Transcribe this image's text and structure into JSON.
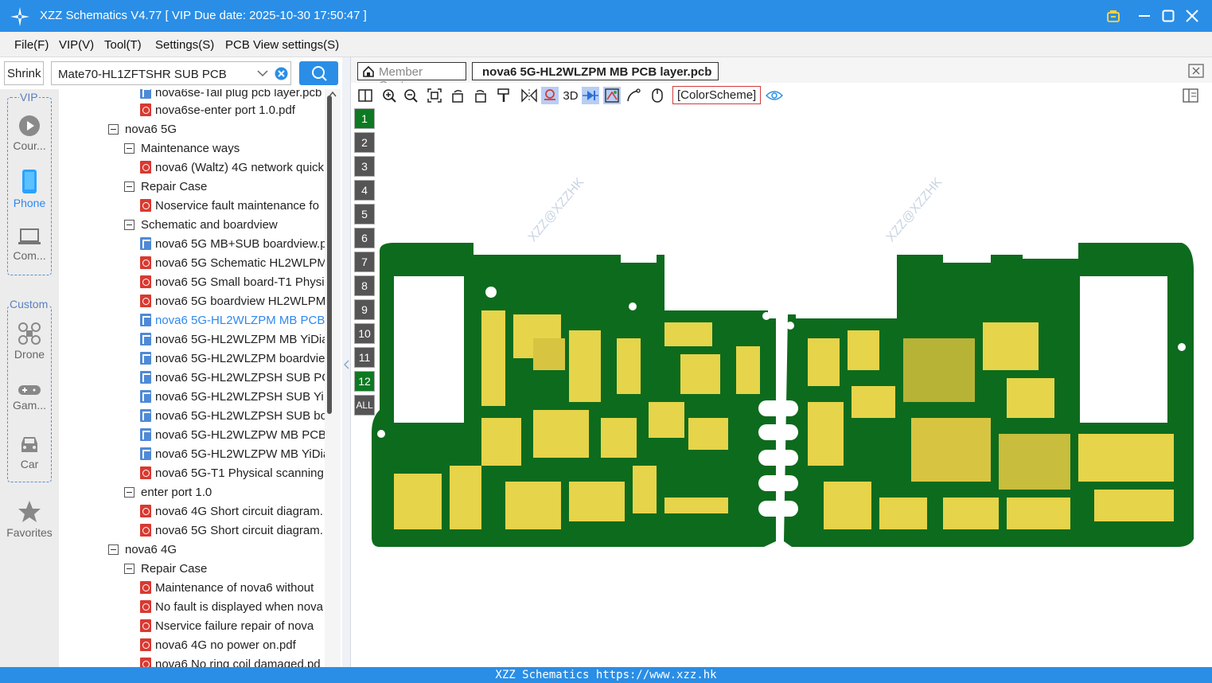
{
  "window": {
    "title": "XZZ Schematics V4.77 [ VIP Due date: 2025-10-30 17:50:47 ]",
    "icons": [
      "app-logo-icon",
      "vip-bag-icon",
      "minimize-icon",
      "maximize-icon",
      "close-icon"
    ]
  },
  "menu": {
    "file": "File(F)",
    "vip": "VIP(V)",
    "tool": "Tool(T)",
    "settings": "Settings(S)",
    "pcbview": "PCB View settings(S)"
  },
  "search": {
    "shrink_label": "Shrink",
    "model_value": "Mate70-HL1ZFTSHR SUB PCB"
  },
  "sidebar": {
    "vip_group": "VIP",
    "custom_group": "Custom",
    "items": [
      {
        "label": "Cour...",
        "icon": "play-icon"
      },
      {
        "label": "Phone",
        "icon": "phone-icon"
      },
      {
        "label": "Com...",
        "icon": "laptop-icon"
      },
      {
        "label": "Drone",
        "icon": "drone-icon"
      },
      {
        "label": "Gam...",
        "icon": "gamepad-icon"
      },
      {
        "label": "Car",
        "icon": "car-icon"
      },
      {
        "label": "Favorites",
        "icon": "star-icon"
      }
    ]
  },
  "tree": [
    {
      "label": "nova6se-Tail plug pcb layer.pcb",
      "type": "pcb"
    },
    {
      "label": "nova6se-enter port 1.0.pdf",
      "type": "pdf"
    },
    {
      "label": "nova6 5G",
      "type": "folder"
    },
    {
      "label": "Maintenance ways",
      "type": "folder"
    },
    {
      "label": "nova6 (Waltz) 4G network quick",
      "type": "pdf"
    },
    {
      "label": "Repair Case",
      "type": "folder"
    },
    {
      "label": "Noservice fault maintenance fo",
      "type": "pdf"
    },
    {
      "label": "Schematic and boardview",
      "type": "folder"
    },
    {
      "label": "nova6 5G MB+SUB boardview.p",
      "type": "pcb"
    },
    {
      "label": "nova6 5G Schematic HL2WLPM",
      "type": "pdf"
    },
    {
      "label": "nova6 5G Small board-T1 Physi",
      "type": "pdf"
    },
    {
      "label": "nova6 5G boardview HL2WLPM",
      "type": "pdf"
    },
    {
      "label": "nova6 5G-HL2WLZPM MB PCB",
      "type": "pcb"
    },
    {
      "label": "nova6 5G-HL2WLZPM MB YiDia",
      "type": "pcb"
    },
    {
      "label": "nova6 5G-HL2WLZPM boardvie",
      "type": "pcb"
    },
    {
      "label": "nova6 5G-HL2WLZPSH SUB PCE",
      "type": "pcb"
    },
    {
      "label": "nova6 5G-HL2WLZPSH SUB YiD",
      "type": "pcb"
    },
    {
      "label": "nova6 5G-HL2WLZPSH SUB boa",
      "type": "pcb"
    },
    {
      "label": "nova6 5G-HL2WLZPW MB PCB",
      "type": "pcb"
    },
    {
      "label": "nova6 5G-HL2WLZPW MB YiDia",
      "type": "pcb"
    },
    {
      "label": "nova6 5G-T1 Physical scanning",
      "type": "pdf"
    },
    {
      "label": "enter port 1.0",
      "type": "folder"
    },
    {
      "label": "nova6 4G Short circuit diagram.",
      "type": "pdf"
    },
    {
      "label": "nova6 5G Short circuit diagram.",
      "type": "pdf"
    },
    {
      "label": "nova6 4G",
      "type": "folder"
    },
    {
      "label": "Repair Case",
      "type": "folder"
    },
    {
      "label": "Maintenance of nova6 without",
      "type": "pdf"
    },
    {
      "label": "No fault is displayed when nova",
      "type": "pdf"
    },
    {
      "label": "Nservice failure repair of nova",
      "type": "pdf"
    },
    {
      "label": "nova6 4G no power on.pdf",
      "type": "pdf"
    },
    {
      "label": "nova6 No ring coil damaged.pd",
      "type": "pdf"
    }
  ],
  "tabs": {
    "member_center": "Member Center",
    "active_file": "nova6 5G-HL2WLZPM MB PCB layer.pcb"
  },
  "toolbar": {
    "three_d": "3D",
    "color_scheme": "[ColorScheme]"
  },
  "layers": [
    "1",
    "2",
    "3",
    "4",
    "5",
    "6",
    "7",
    "8",
    "9",
    "10",
    "11",
    "12",
    "ALL"
  ],
  "active_layers": [
    "1",
    "12"
  ],
  "watermark": "XZZ@XZZHK",
  "colors": {
    "accent": "#2a8ee6",
    "board": "#0d6b1d",
    "pads": "#e6d44a",
    "link": "#2e88f0"
  },
  "status": "XZZ Schematics https://www.xzz.hk"
}
